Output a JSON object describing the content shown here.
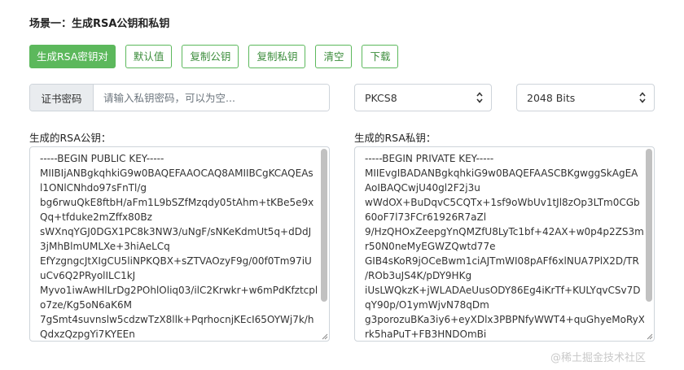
{
  "section": {
    "title": "场景一：生成RSA公钥和私钥"
  },
  "buttons": {
    "generate": "生成RSA密钥对",
    "default": "默认值",
    "copy_public": "复制公钥",
    "copy_private": "复制私钥",
    "clear": "清空",
    "download": "下载"
  },
  "password": {
    "label": "证书密码",
    "placeholder": "请输入私钥密码，可以为空...",
    "value": ""
  },
  "format_select": {
    "selected": "PKCS8"
  },
  "bits_select": {
    "selected": "2048 Bits"
  },
  "public_key": {
    "label": "生成的RSA公钥：",
    "lines": [
      "-----BEGIN PUBLIC KEY-----",
      "MIIBIjANBgkqhkiG9w0BAQEFAAOCAQ8AMIIBCgKCAQEAs",
      "l1ONlCNhdo97sFnTl/g",
      "bg6rwuQkE8ftbH/aFm1L9bSZfMzqdy05tAhm+tKBe5e9x",
      "Qq+tfduke2mZffx80Bz",
      "sWXnqYGJ0DGX1PC8k3NW3/uNgF/sNKeKdmUt5q+dDdJ",
      "3jMhBlmUMLXe+3hiAeLCq",
      "EfYzgngcJtXIgCU5liNPKQBX+sZTVAOzyF9g/00f0Tm97iU",
      "uCv6Q2PRyolILC1kJ",
      "Myvo1iwAwHlLrDg2POhlOliq03/ilC2Krwkr+w6mPdKfztcpl",
      "o7ze/Kg5oN6aK6M",
      "7gSmt4suvnslw5cdzwTzX8llk+PqrhocnjKEcI65OYWj7k/h",
      "QdxzQzpgYi7KYEEn"
    ]
  },
  "private_key": {
    "label": "生成的RSA私钥：",
    "lines": [
      "-----BEGIN PRIVATE KEY-----",
      "MIIEvgIBADANBgkqhkiG9w0BAQEFAASCBKgwggSkAgEA",
      "AoIBAQCwjU40gl2F2j3u",
      "wWdOX+BuDqvC5CQTx+1sf9oWbUv1tJl8zOp3LTm0CGb",
      "60oF7l73FCr61926R7aZl",
      "9/HzQHOxZeepgYnQMZfU8LyTc1bf+42AX+w0p4p2ZS3m",
      "r50N0neMyEGWZQwtd77e",
      "GIB4sKoR9jOCeBwm1ciAJTmWI08pAFf6xlNUA7PlX2D/TR",
      "/ROb3uJS4K/pDY9HKg",
      "iUsLWQkzK+jWLADAeUusODY86Eg4iKrTf+KULYqvCSv7D",
      "qY90p/O1ymWjvN78qDm",
      "g3porozuBKa3iy6+eyXDlx3PBPNfyWWT4+quGhyeMoRyX",
      "rk5haPuT+FB3HNDOmBi"
    ]
  },
  "watermark": {
    "text": "@稀土掘金技术社区"
  }
}
